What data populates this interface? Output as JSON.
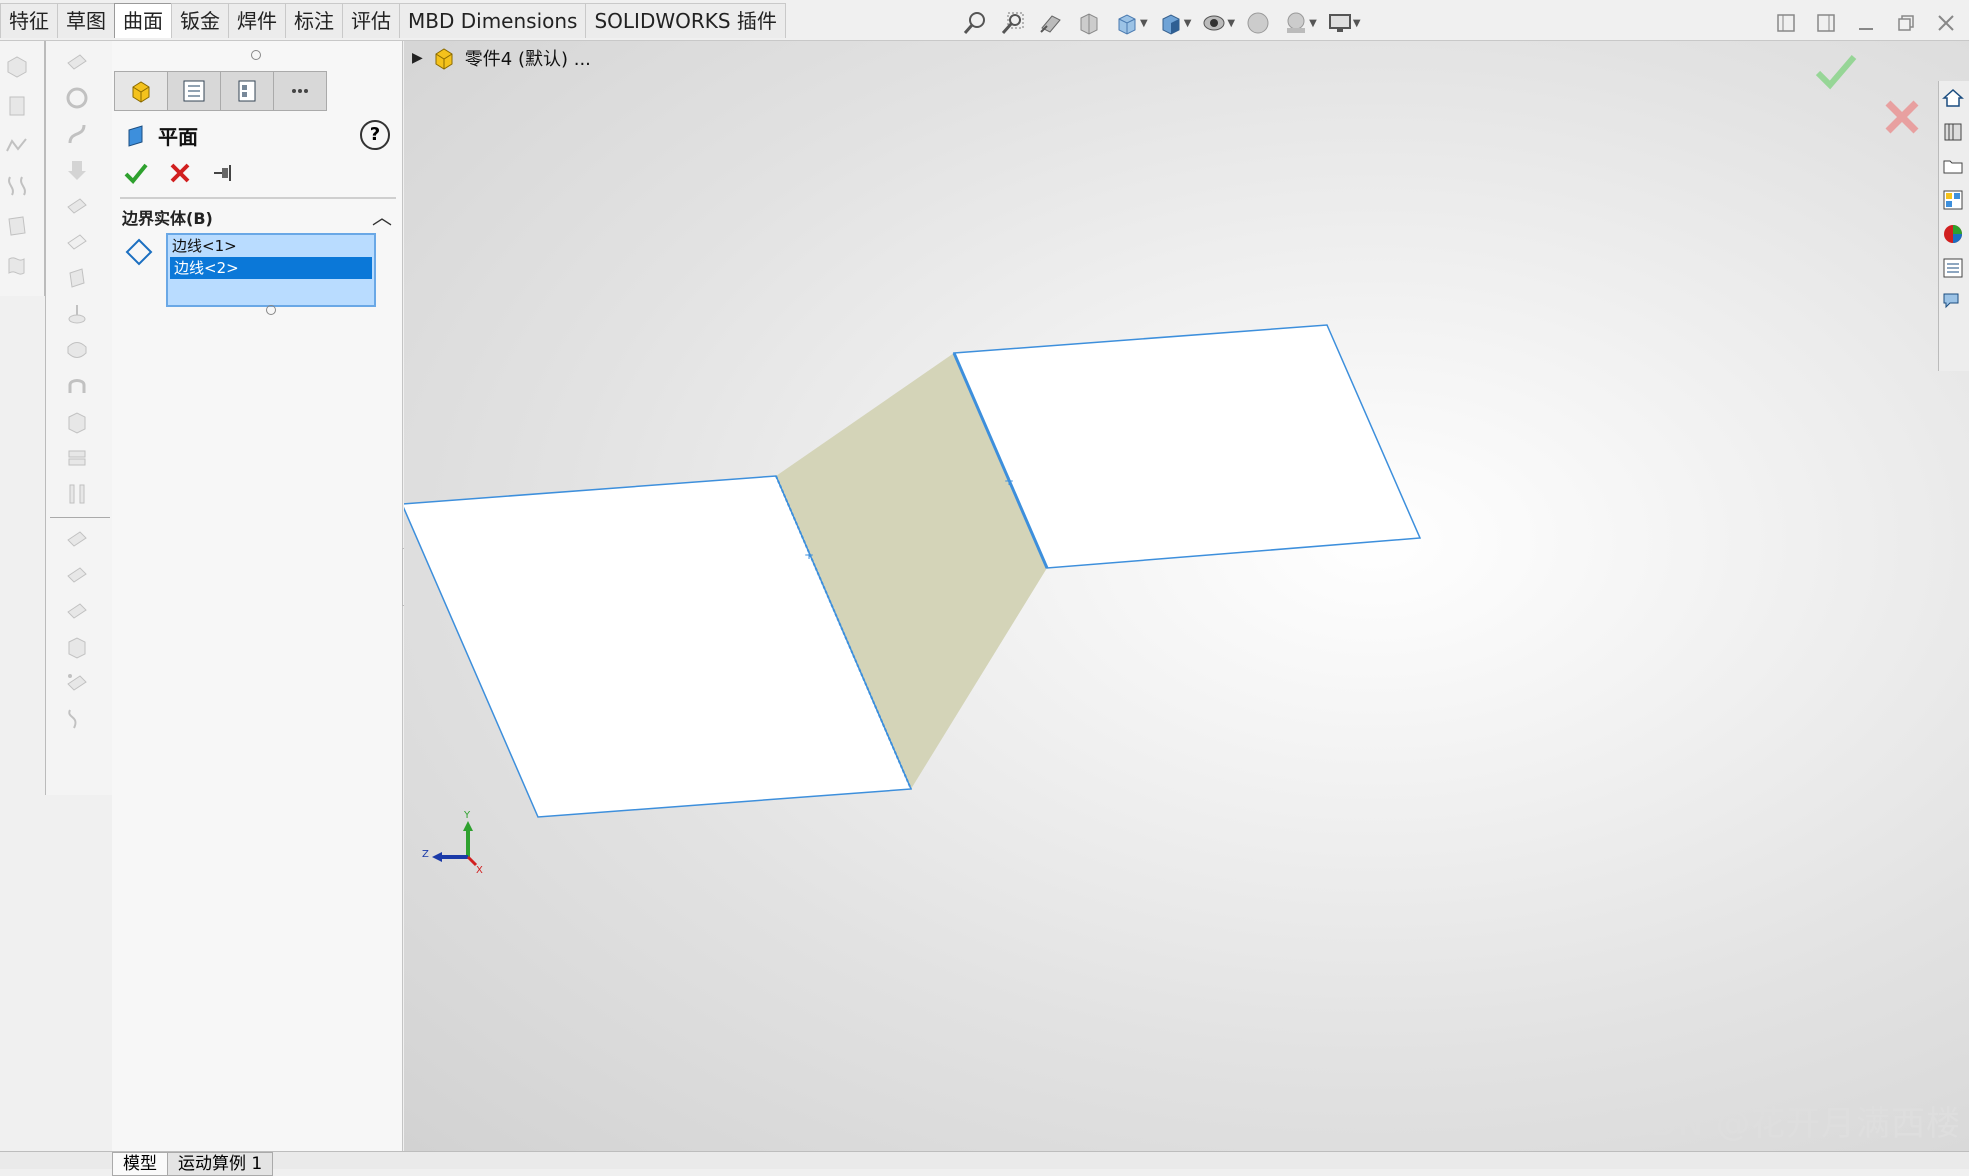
{
  "tabbar": {
    "tabs": [
      {
        "label": "特征",
        "active": false
      },
      {
        "label": "草图",
        "active": false
      },
      {
        "label": "曲面",
        "active": true
      },
      {
        "label": "钣金",
        "active": false
      },
      {
        "label": "焊件",
        "active": false
      },
      {
        "label": "标注",
        "active": false
      },
      {
        "label": "评估",
        "active": false
      },
      {
        "label": "MBD Dimensions",
        "active": false
      },
      {
        "label": "SOLIDWORKS 插件",
        "active": false
      }
    ]
  },
  "property_manager": {
    "title": "平面",
    "help_label": "?",
    "section_title": "边界实体(B)",
    "list_items": [
      {
        "text": "边线<1>",
        "selected": false
      },
      {
        "text": "边线<2>",
        "selected": true
      }
    ]
  },
  "viewport": {
    "tree_label": "零件4 (默认) ...",
    "triad": {
      "x_label": "X",
      "y_label": "Y",
      "z_label": "Z"
    },
    "watermark": "CSDN @花开月满西楼"
  },
  "bottom_tabs": [
    {
      "label": "模型",
      "active": true
    },
    {
      "label": "运动算例 1",
      "active": false
    }
  ],
  "colors": {
    "accent": "#0b78d8",
    "surface_fill": "#d4d4b8",
    "edge_blue": "#3d8fdc",
    "ok_green": "#2ea12e",
    "cancel_red": "#d11f1f"
  }
}
